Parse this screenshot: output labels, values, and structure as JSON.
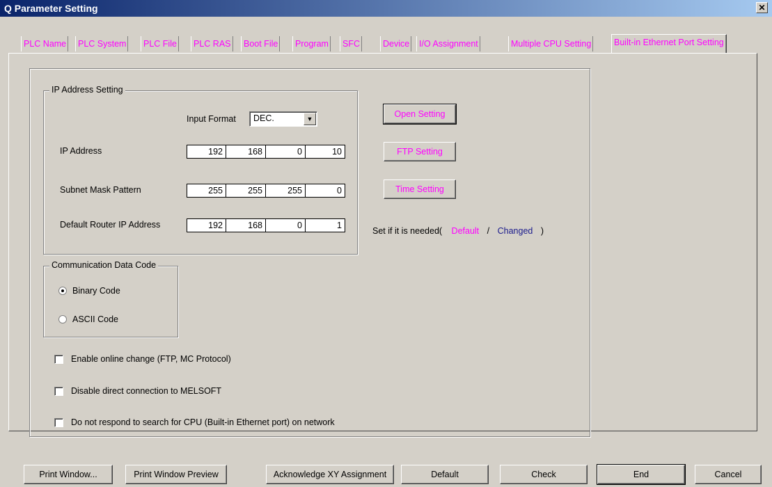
{
  "window": {
    "title": "Q Parameter Setting",
    "close_glyph": "✕"
  },
  "tabs": [
    {
      "label": "PLC Name"
    },
    {
      "label": "PLC System"
    },
    {
      "label": "PLC File"
    },
    {
      "label": "PLC RAS"
    },
    {
      "label": "Boot File"
    },
    {
      "label": "Program"
    },
    {
      "label": "SFC"
    },
    {
      "label": "Device"
    },
    {
      "label": "I/O Assignment"
    },
    {
      "label": "Multiple CPU Setting"
    },
    {
      "label": "Built-in Ethernet Port Setting"
    }
  ],
  "ip_group": {
    "title": "IP Address Setting",
    "input_format_label": "Input Format",
    "input_format_value": "DEC.",
    "ip_label": "IP Address",
    "ip": [
      "192",
      "168",
      "0",
      "10"
    ],
    "subnet_label": "Subnet Mask Pattern",
    "subnet": [
      "255",
      "255",
      "255",
      "0"
    ],
    "router_label": "Default Router IP Address",
    "router": [
      "192",
      "168",
      "0",
      "1"
    ]
  },
  "side_buttons": {
    "open": "Open Setting",
    "ftp": "FTP Setting",
    "time": "Time Setting"
  },
  "hint": {
    "prefix": "Set if it is needed(",
    "default": "Default",
    "slash": "/",
    "changed": "Changed",
    "suffix": ")"
  },
  "comm_group": {
    "title": "Communication Data Code",
    "binary": "Binary Code",
    "ascii": "ASCII Code"
  },
  "checkboxes": {
    "online_change": "Enable online change (FTP, MC Protocol)",
    "disable_direct": "Disable direct connection to MELSOFT",
    "no_respond": "Do not respond to search for CPU (Built-in Ethernet port) on network"
  },
  "bottom_buttons": {
    "print_window": "Print Window...",
    "print_preview": "Print Window Preview",
    "ack_xy": "Acknowledge XY Assignment",
    "default": "Default",
    "check": "Check",
    "end": "End",
    "cancel": "Cancel"
  },
  "colors": {
    "tab_text": "#ff00ff",
    "title_bar": "#0a246a",
    "changed_link": "#1a1a8c"
  }
}
